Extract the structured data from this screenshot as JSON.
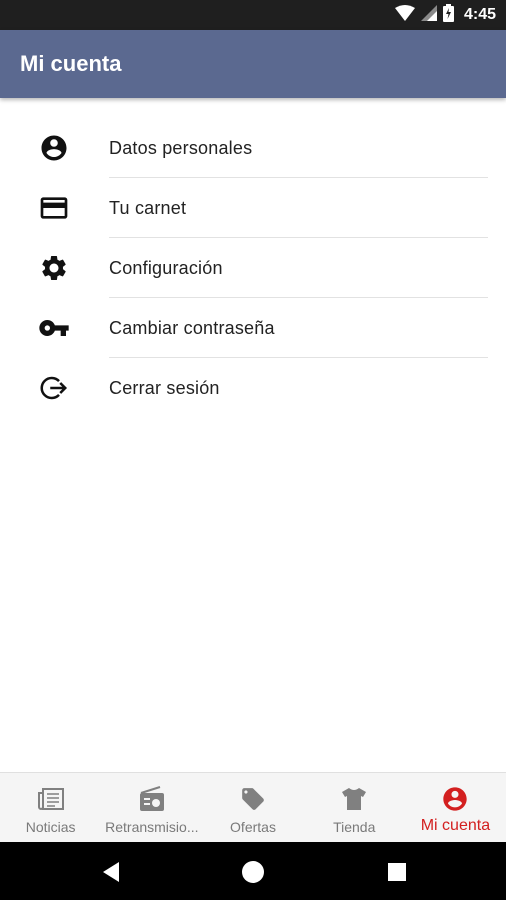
{
  "status_bar": {
    "time": "4:45",
    "icons": [
      "wifi-icon",
      "signal-icon",
      "battery-icon"
    ]
  },
  "app_bar": {
    "title": "Mi cuenta",
    "color": "#5b6990"
  },
  "menu": {
    "items": [
      {
        "label": "Datos personales",
        "icon": "account-circle-icon"
      },
      {
        "label": "Tu carnet",
        "icon": "credit-card-icon"
      },
      {
        "label": "Configuración",
        "icon": "gear-icon"
      },
      {
        "label": "Cambiar contraseña",
        "icon": "key-icon"
      },
      {
        "label": "Cerrar sesión",
        "icon": "logout-icon"
      }
    ]
  },
  "bottom_nav": {
    "items": [
      {
        "label": "Noticias",
        "icon": "newspaper-icon"
      },
      {
        "label": "Retransmisio...",
        "icon": "radio-icon"
      },
      {
        "label": "Ofertas",
        "icon": "tag-icon"
      },
      {
        "label": "Tienda",
        "icon": "shirt-icon"
      },
      {
        "label": "Mi cuenta",
        "icon": "account-circle-icon",
        "active": true
      }
    ],
    "active_color": "#d32020",
    "inactive_color": "#7a7a7a"
  },
  "system_nav": {
    "buttons": [
      "back-icon",
      "home-icon",
      "recents-icon"
    ]
  }
}
